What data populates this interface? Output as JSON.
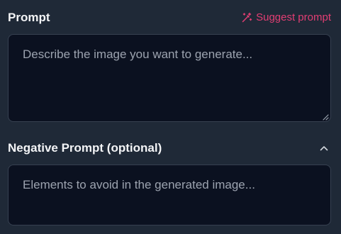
{
  "prompt": {
    "label": "Prompt",
    "suggest_label": "Suggest prompt",
    "suggest_icon": "magic-wand-icon",
    "placeholder": "Describe the image you want to generate..."
  },
  "negative_prompt": {
    "label": "Negative Prompt (optional)",
    "collapse_icon": "chevron-up-icon",
    "placeholder": "Elements to avoid in the generated image..."
  },
  "colors": {
    "background": "#1f2937",
    "field_background": "#0b1120",
    "accent": "#e23e73",
    "label": "#f3f4f6",
    "placeholder": "#9ca3af"
  }
}
